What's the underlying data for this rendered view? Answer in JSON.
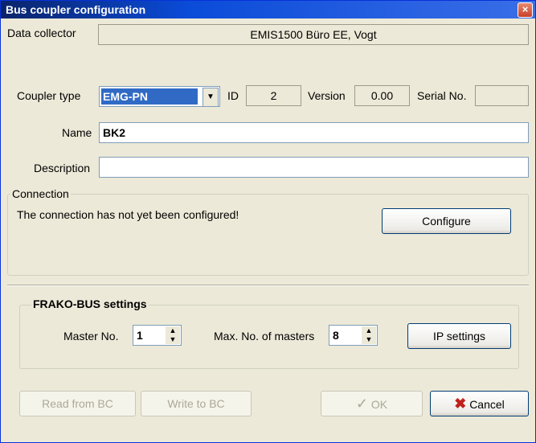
{
  "window": {
    "title": "Bus coupler configuration",
    "close_glyph": "×"
  },
  "data_collector": {
    "label": "Data collector",
    "value": "EMIS1500 Büro EE, Vogt"
  },
  "coupler": {
    "type_label": "Coupler type",
    "type_value": "EMG-PN",
    "id_label": "ID",
    "id_value": "2",
    "version_label": "Version",
    "version_value": "0.00",
    "serial_label": "Serial No.",
    "serial_value": ""
  },
  "name": {
    "label": "Name",
    "value": "BK2"
  },
  "description": {
    "label": "Description",
    "value": ""
  },
  "connection": {
    "group_label": "Connection",
    "status": "The connection has not yet been configured!",
    "configure_button": "Configure"
  },
  "frako": {
    "group_label": "FRAKO-BUS settings",
    "master_label": "Master No.",
    "master_value": "1",
    "max_masters_label": "Max. No. of masters",
    "max_masters_value": "8",
    "ip_button": "IP settings"
  },
  "footer": {
    "read_button": "Read from BC",
    "write_button": "Write to BC",
    "ok_button": "OK",
    "cancel_button": "Cancel"
  },
  "icons": {
    "ok": "checkmark-icon",
    "cancel": "red-x-icon",
    "dropdown": "chevron-down-icon",
    "spin": "spin-arrows-icon"
  }
}
